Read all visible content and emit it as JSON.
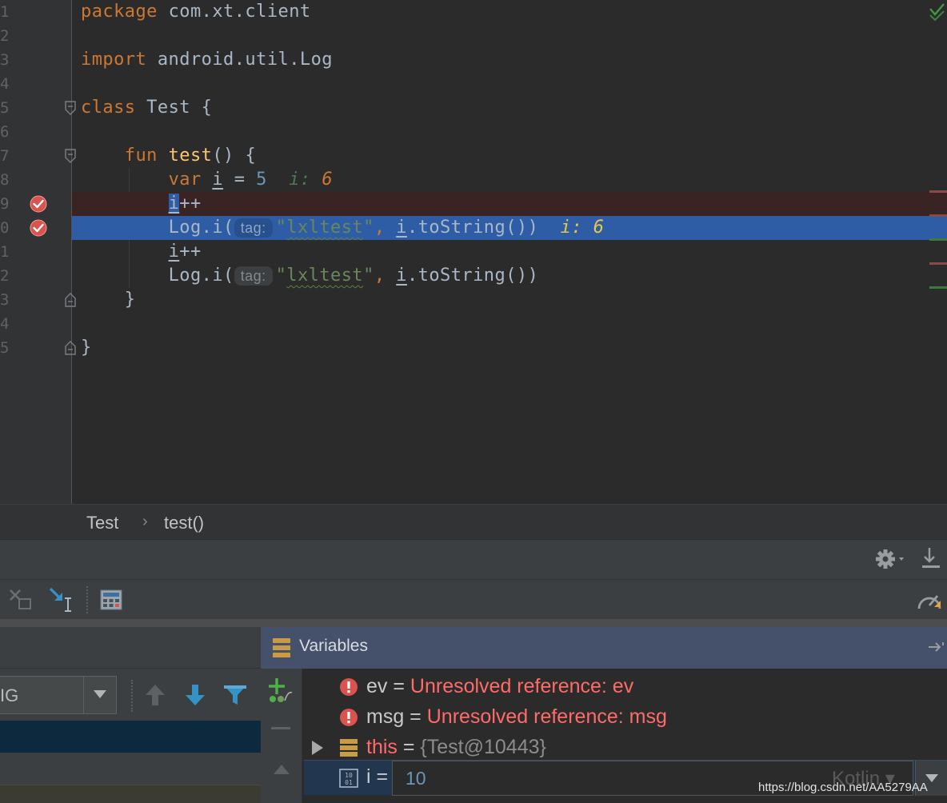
{
  "editor": {
    "line_numbers": [
      "1",
      "2",
      "3",
      "4",
      "5",
      "6",
      "7",
      "8",
      "9",
      "0",
      "1",
      "2",
      "3",
      "4",
      "5"
    ],
    "code": {
      "l1_kw": "package",
      "l1_rest": " com.xt.client",
      "l3_kw": "import",
      "l3_rest": " android.util.Log",
      "l5_kw": "class",
      "l5_rest": " Test {",
      "l7_kw": "fun",
      "l7_fn": "test",
      "l7_rest": "() {",
      "l8_kw": "var",
      "l8_var": "i",
      "l8_eq": " = ",
      "l8_num": "5",
      "l8_iv_name": "i:",
      "l8_iv_val": "6",
      "l9_var": "i",
      "l9_op": "++",
      "l10_call": "Log.i(",
      "l10_hint": "tag:",
      "l10_q1": "\"",
      "l10_str": "lxltest",
      "l10_q2": "\"",
      "l10_comma": ", ",
      "l10_var": "i",
      "l10_rest": ".toString())",
      "l10_iv_name": "i:",
      "l10_iv_val": "6",
      "l11_var": "i",
      "l11_op": "++",
      "l12_call": "Log.i(",
      "l12_hint": "tag:",
      "l12_q1": "\"",
      "l12_str": "lxltest",
      "l12_q2": "\"",
      "l12_comma": ", ",
      "l12_var": "i",
      "l12_rest": ".toString())",
      "l13": "}",
      "l15": "}"
    }
  },
  "breadcrumb": {
    "items": [
      "Test",
      "test()"
    ],
    "separator": "›"
  },
  "thread_combo": {
    "value": "IG"
  },
  "variables": {
    "title": "Variables",
    "rows": [
      {
        "name": "ev",
        "eq": " = ",
        "value": "Unresolved reference: ev"
      },
      {
        "name": "msg",
        "eq": " = ",
        "value": "Unresolved reference: msg"
      },
      {
        "name": "this",
        "eq": " = ",
        "value": "{Test@10443}"
      }
    ],
    "watch": {
      "name": "i",
      "eq": " = ",
      "value": "10",
      "language": "Kotlin"
    }
  },
  "watermark": "https://blog.csdn.net/AA5279AA",
  "colors": {
    "background": "#2b2b2b",
    "gutter": "#313335",
    "execution_line": "#2e5da6",
    "breakpoint_line": "#3a2323",
    "keyword": "#cc7832",
    "string": "#6a8759",
    "number": "#6897bb",
    "error": "#ff6b68"
  },
  "icons": [
    "breakpoint-icon",
    "fold-icon",
    "check-icon",
    "settings-icon",
    "download-icon",
    "close-debug-icon",
    "step-into-icon",
    "calculator-icon",
    "speedometer-icon",
    "variables-icon",
    "add-watch-icon",
    "minus-icon",
    "arrow-up-icon",
    "arrow-down-icon",
    "filter-icon",
    "error-icon",
    "expand-icon",
    "object-icon",
    "binary-icon",
    "chevron-down-icon"
  ]
}
